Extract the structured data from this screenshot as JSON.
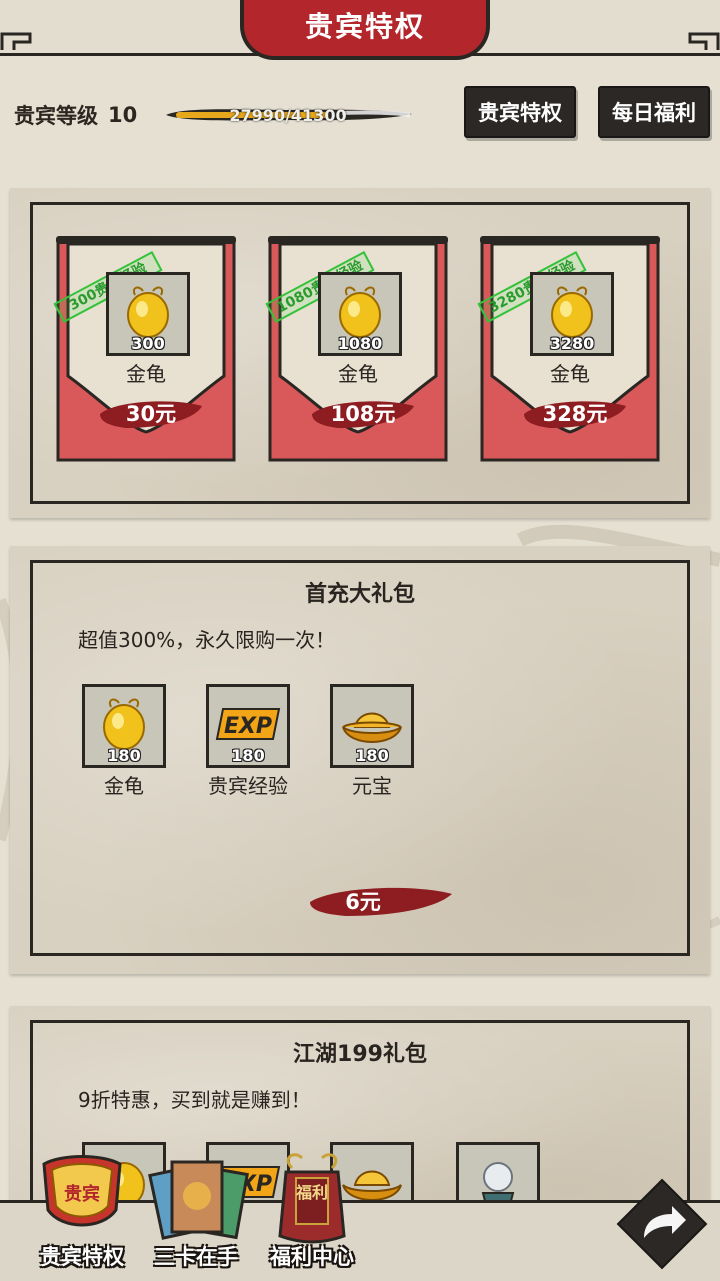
{
  "header": {
    "title": "贵宾特权"
  },
  "vip": {
    "level_label": "贵宾等级",
    "level_value": "10",
    "exp_text": "27990/41300",
    "exp_progress": 0.678,
    "btn_privilege": "贵宾特权",
    "btn_daily": "每日福利"
  },
  "recharge_tiers": [
    {
      "stamp": "300贵宾经验",
      "item_name": "金龟",
      "item_qty": "300",
      "price": "30元",
      "icon": "golden-turtle-icon"
    },
    {
      "stamp": "1080贵宾经验",
      "item_name": "金龟",
      "item_qty": "1080",
      "price": "108元",
      "icon": "golden-turtle-icon"
    },
    {
      "stamp": "3280贵宾经验",
      "item_name": "金龟",
      "item_qty": "3280",
      "price": "328元",
      "icon": "golden-turtle-icon"
    }
  ],
  "first_pack": {
    "title": "首充大礼包",
    "desc": "超值300%，永久限购一次！",
    "items": [
      {
        "name": "金龟",
        "qty": "180",
        "icon": "golden-turtle-icon"
      },
      {
        "name": "贵宾经验",
        "qty": "180",
        "icon": "exp-icon"
      },
      {
        "name": "元宝",
        "qty": "180",
        "icon": "gold-ingot-icon"
      }
    ],
    "price": "6元"
  },
  "jianghu_pack": {
    "title": "江湖199礼包",
    "desc": "9折特惠，买到就是赚到！",
    "items": [
      {
        "icon": "golden-turtle-icon"
      },
      {
        "icon": "exp-icon"
      },
      {
        "icon": "gold-ingot-icon"
      },
      {
        "icon": "crystal-ball-icon"
      }
    ]
  },
  "bottom_nav": {
    "items": [
      {
        "label": "贵宾特权",
        "badge": "贵宾",
        "icon": "vip-shield-icon"
      },
      {
        "label": "三卡在手",
        "icon": "cards-icon"
      },
      {
        "label": "福利中心",
        "badge": "福利",
        "icon": "welfare-bag-icon"
      }
    ]
  },
  "colors": {
    "accent_red": "#b3262c",
    "banner_red": "#d9585a",
    "ink": "#2a2622",
    "paper": "#d8d0c0",
    "stamp_green": "#34c23a"
  }
}
